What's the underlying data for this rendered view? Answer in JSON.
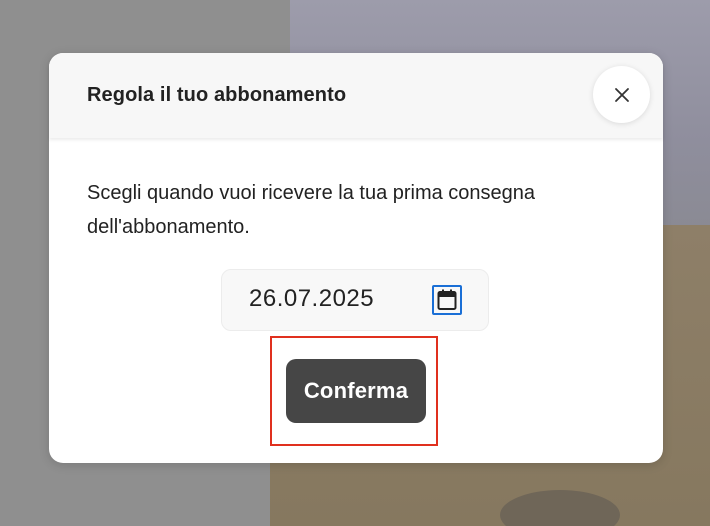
{
  "modal": {
    "title": "Regola il tuo abbonamento",
    "description": "Scegli quando vuoi ricevere la tua prima consegna dell'abbonamento.",
    "close_icon": "close-icon",
    "date_field": {
      "value": "26.07.2025",
      "icon": "calendar-icon",
      "focus_color": "#1a6fd6"
    },
    "confirm_label": "Conferma"
  },
  "colors": {
    "button_bg": "#464646",
    "highlight": "#e0301e",
    "header_bg": "#f7f7f7"
  }
}
